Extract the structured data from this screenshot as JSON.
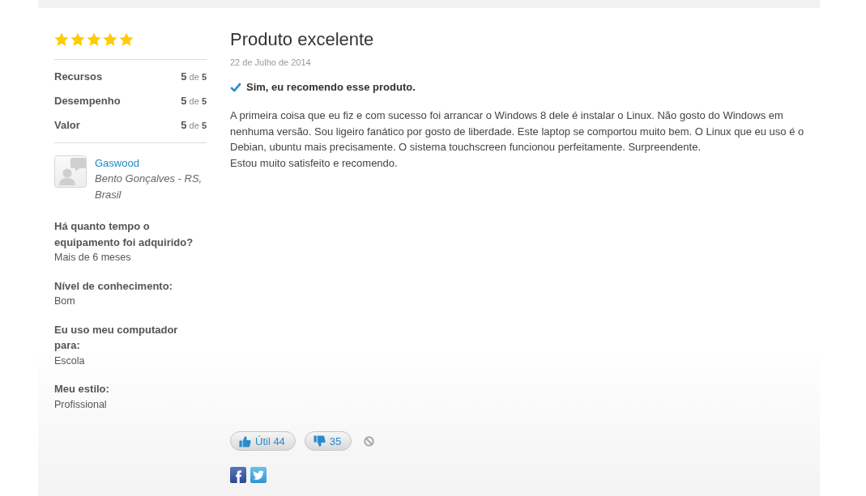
{
  "rating": {
    "stars": 5
  },
  "criteria": [
    {
      "label": "Recursos",
      "score": "**5** de **5**"
    },
    {
      "label": "Desempenho",
      "score": "**5** de **5**"
    },
    {
      "label": "Valor",
      "score": "**5** de **5**"
    }
  ],
  "reviewer": {
    "name": "Gaswood",
    "location": "Bento Gonçalves - RS, Brasil"
  },
  "details": [
    {
      "question": "Há quanto tempo o equipamento foi adquirido?",
      "answer": "Mais de 6 meses"
    },
    {
      "question": "Nível de conhecimento:",
      "answer": "Bom"
    },
    {
      "question": "Eu uso meu computador para:",
      "answer": "Escola"
    },
    {
      "question": "Meu estilo:",
      "answer": "Profissional"
    }
  ],
  "review": {
    "title": "Produto excelente",
    "date": "22 de Julho de 2014",
    "recommendation": {
      "recommended": true,
      "text": "Sim, eu recomendo esse produto."
    },
    "body": "A primeira coisa que eu fiz e com sucesso foi arrancar o Windows 8 dele é instalar o Linux. Não gosto do Windows em nenhuma versão. Sou ligeiro fanático por gosto de liberdade. Este laptop se comportou muito bem. O Linux que eu uso é o Debian, ubuntu mais precisamente. O sistema touchscreen funcionou perfeitamente. Surpreendente.\nEstou muito satisfeito e recomendo."
  },
  "votes": [
    {
      "kind": "helpful",
      "label": "Útil 44"
    },
    {
      "kind": "unhelpful",
      "label": "35"
    }
  ]
}
